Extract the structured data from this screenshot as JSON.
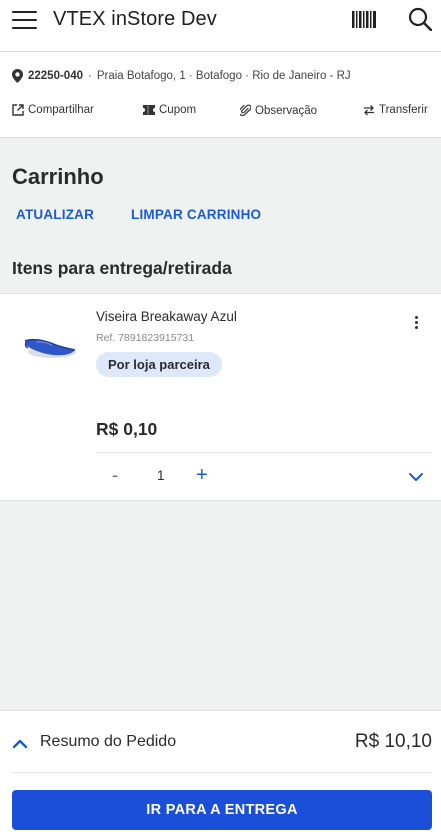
{
  "header": {
    "title": "VTEX inStore Dev",
    "menu_icon": "hamburger-menu-icon",
    "barcode_icon": "barcode-scanner-icon",
    "search_icon": "search-icon"
  },
  "address": {
    "zip": "22250-040",
    "separator": "·",
    "text": "Praia Botafogo, 1 · Botafogo · Rio de Janeiro - RJ",
    "icon": "location-pin-icon"
  },
  "actions": [
    {
      "label": "Compartilhar",
      "icon": "share-icon"
    },
    {
      "label": "Cupom",
      "icon": "coupon-icon"
    },
    {
      "label": "Observação",
      "icon": "paperclip-icon"
    },
    {
      "label": "Transferir",
      "icon": "transfer-arrows-icon"
    }
  ],
  "cart": {
    "title": "Carrinho",
    "update_label": "ATUALIZAR",
    "clear_label": "LIMPAR CARRINHO",
    "section_title": "Itens para entrega/retirada"
  },
  "item": {
    "name": "Viseira Breakaway Azul",
    "ref": "Ref. 7891823915731",
    "badge": "Por loja parceira",
    "price": "R$ 0,10",
    "qty_minus": "-",
    "qty": "1",
    "qty_plus": "+",
    "image": "blue-visor-product-image",
    "menu_icon": "more-vertical-icon",
    "expand_icon": "chevron-down-icon"
  },
  "summary": {
    "label": "Resumo do Pedido",
    "total": "R$ 10,10",
    "chevron_icon": "chevron-up-icon"
  },
  "cta": {
    "label": "IR PARA A ENTREGA"
  },
  "colors": {
    "accent": "#1a5bd8",
    "cta_background": "#1c4fd9",
    "badge_background": "#dde8fb",
    "page_background": "#f0f1f1"
  }
}
